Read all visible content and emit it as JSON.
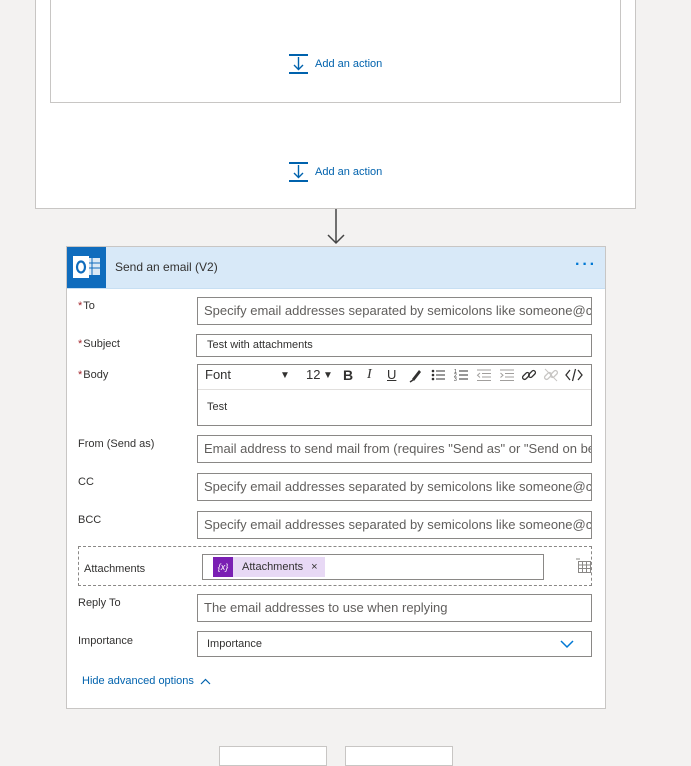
{
  "scope": {
    "inner_add_action": "Add an action",
    "outer_add_action": "Add an action"
  },
  "card": {
    "title": "Send an email (V2)",
    "more": "···",
    "icon": "outlook-icon",
    "header_color": "#d8e9f8"
  },
  "fields": {
    "to": {
      "label": "To",
      "placeholder": "Specify email addresses separated by semicolons like someone@con"
    },
    "subject": {
      "label": "Subject",
      "value": "Test with attachments"
    },
    "body": {
      "label": "Body",
      "font": "Font",
      "size": "12",
      "value": "Test"
    },
    "from": {
      "label": "From (Send as)",
      "placeholder": "Email address to send mail from (requires \"Send as\" or \"Send on beha"
    },
    "cc": {
      "label": "CC",
      "placeholder": "Specify email addresses separated by semicolons like someone@con"
    },
    "bcc": {
      "label": "BCC",
      "placeholder": "Specify email addresses separated by semicolons like someone@con"
    },
    "attachments": {
      "label": "Attachments",
      "token": "Attachments",
      "token_icon": "{x}"
    },
    "reply_to": {
      "label": "Reply To",
      "placeholder": "The email addresses to use when replying"
    },
    "importance": {
      "label": "Importance",
      "value": "Importance"
    }
  },
  "hide_advanced": "Hide advanced options",
  "colors": {
    "accent": "#0078d4",
    "link": "#0062ad",
    "required": "#a4262c",
    "token": "#7a1fb3"
  }
}
